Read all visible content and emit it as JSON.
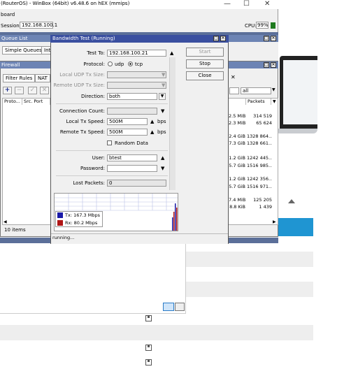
{
  "winbox": {
    "title": "(RouterOS) - WinBox (64bit) v6.48.6 on hEX (mmips)",
    "menu_fragment": "board",
    "session_label": "Session:",
    "session_value": "192.168.100.1",
    "cpu_label": "CPU:",
    "cpu_value": "99%",
    "win_min": "—",
    "win_max": "☐",
    "win_close": "✕"
  },
  "queue_list": {
    "title": "Queue List",
    "tab_simple": "Simple Queues",
    "tab_int": "Int",
    "filter_value": "all",
    "col_packets": "Packets",
    "rows": [
      {
        "bytes": "2.5 MiB",
        "packets": "314 519"
      },
      {
        "bytes": "2.3 MiB",
        "packets": "65 624"
      },
      {
        "bytes": "2.4 GiB",
        "packets": "1328 864..."
      },
      {
        "bytes": "7.3 GiB",
        "packets": "1328 661..."
      },
      {
        "bytes": "1.2 GiB",
        "packets": "1242 445..."
      },
      {
        "bytes": "5.7 GiB",
        "packets": "1516 985..."
      },
      {
        "bytes": "1.2 GiB",
        "packets": "1242 356..."
      },
      {
        "bytes": "5.7 GiB",
        "packets": "1516 971..."
      },
      {
        "bytes": "7.4 MiB",
        "packets": "125 205"
      },
      {
        "bytes": "8.8 KiB",
        "packets": "1 439"
      }
    ]
  },
  "firewall": {
    "title": "Firewall",
    "tab_filter": "Filter Rules",
    "tab_nat": "NAT",
    "col_proto": "Proto...",
    "col_src_port": "Src. Port",
    "items_count": "10 items"
  },
  "bandwidth_test": {
    "title": "Bandwidth Test (Running)",
    "test_to_label": "Test To:",
    "test_to_value": "192.168.100.21",
    "protocol_label": "Protocol:",
    "protocol_udp": "udp",
    "protocol_tcp": "tcp",
    "local_udp_label": "Local UDP Tx Size:",
    "remote_udp_label": "Remote UDP Tx Size:",
    "direction_label": "Direction:",
    "direction_value": "both",
    "connection_count_label": "Connection Count:",
    "local_tx_label": "Local Tx Speed:",
    "local_tx_value": "500M",
    "remote_tx_label": "Remote Tx Speed:",
    "remote_tx_value": "500M",
    "bps": "bps",
    "random_data": "Random Data",
    "user_label": "User:",
    "user_value": "btest",
    "password_label": "Password:",
    "lost_packets_label": "Lost Packets:",
    "lost_packets_value": "0",
    "legend_tx": "Tx:  167.3 Mbps",
    "legend_rx": "Rx:  80.2 Mbps",
    "status": "running...",
    "btn_start": "Start",
    "btn_stop": "Stop",
    "btn_close": "Close",
    "tx_color": "#1a1aa8",
    "rx_color": "#b01515"
  }
}
